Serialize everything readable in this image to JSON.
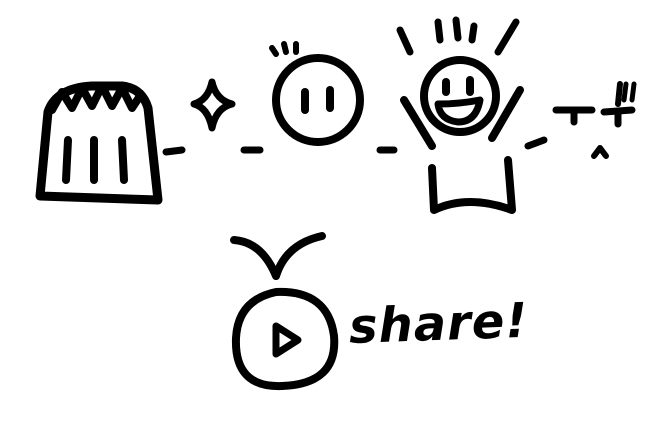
{
  "drawing": {
    "steps": [
      {
        "icon": "basket-with-zigzag-icon"
      },
      {
        "icon": "sparkle-icon"
      },
      {
        "icon": "surprised-face-icon"
      },
      {
        "icon": "excited-cheering-figure-icon"
      },
      {
        "icon": "exclamation-marks-icon"
      }
    ],
    "arrow_icon": "curved-arrow-down-icon",
    "play_icon": "play-button-icon",
    "share_label": "share!",
    "stroke_color": "#000000",
    "background_color": "#ffffff"
  }
}
